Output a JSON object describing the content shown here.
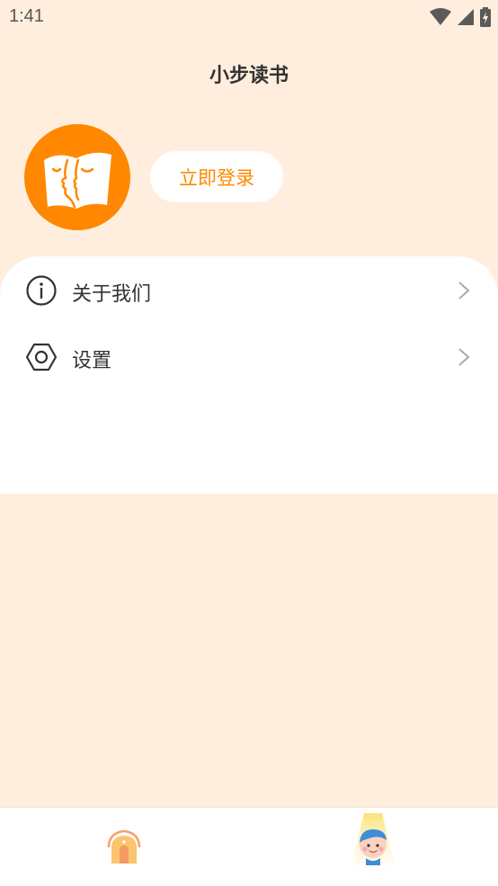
{
  "status_bar": {
    "time": "1:41",
    "icons": [
      "wifi-icon",
      "signal-icon",
      "battery-charging-icon"
    ]
  },
  "header": {
    "title": "小步读书"
  },
  "profile": {
    "avatar_icon": "book-faces-logo",
    "login_label": "立即登录"
  },
  "menu": {
    "items": [
      {
        "label": "关于我们",
        "icon": "info-icon"
      },
      {
        "label": "设置",
        "icon": "settings-hexagon-icon"
      }
    ]
  },
  "tabbar": {
    "tabs": [
      {
        "icon": "home-house-icon",
        "active": false
      },
      {
        "icon": "profile-child-icon",
        "active": true
      }
    ]
  },
  "colors": {
    "background": "#FFEEDD",
    "accent": "#FF8800",
    "card": "#FFFFFF",
    "text": "#333333"
  }
}
